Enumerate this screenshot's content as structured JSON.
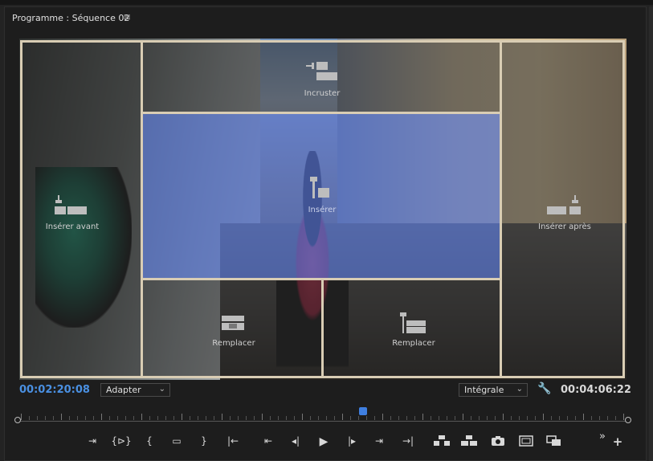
{
  "panel": {
    "title": "Programme : Séquence 02",
    "menu_glyph": "≡"
  },
  "zones": {
    "incruster": "Incruster",
    "inserer": "Insérer",
    "inserer_avant": "Insérer avant",
    "inserer_apres": "Insérer après",
    "remplacer_left": "Remplacer",
    "remplacer_right": "Remplacer"
  },
  "timecode": {
    "current": "00:02:20:08",
    "duration": "00:04:06:22"
  },
  "zoom_select": {
    "value": "Adapter"
  },
  "resolution_select": {
    "value": "Intégrale"
  },
  "playback": {
    "position": 0.567
  },
  "colors": {
    "accent": "#4a90e2",
    "drop_highlight": "#506ec8"
  },
  "toolbar": {
    "icons": [
      "add-marker-icon",
      "mark-in-out-icon",
      "mark-in-icon",
      "comment-icon",
      "mark-out-icon",
      "go-to-in-icon",
      "step-back-many-icon",
      "step-back-icon",
      "play-icon",
      "step-forward-icon",
      "step-forward-many-icon",
      "go-to-out-icon",
      "lift-icon",
      "extract-icon",
      "export-frame-icon",
      "safe-margins-icon",
      "comparison-view-icon",
      "more-icon",
      "add-button-icon"
    ],
    "glyphs": {
      "add_marker": "⇥",
      "mark_in_out": "{⊳}",
      "mark_in": "{",
      "comment": "▭",
      "mark_out": "}",
      "go_to_in": "|←",
      "step_back_many": "⇤",
      "step_back": "◂|",
      "play": "▶",
      "step_forward": "|▸",
      "step_forward_many": "⇥",
      "go_to_out": "→|",
      "more": "»",
      "add": "+"
    }
  }
}
